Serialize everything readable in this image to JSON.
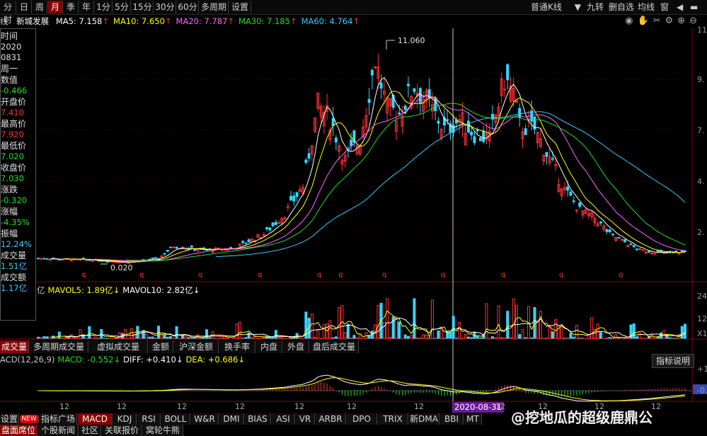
{
  "toolbar": {
    "periods": [
      "分时",
      "日",
      "周",
      "月",
      "季",
      "年",
      "1分",
      "5分",
      "15分",
      "30分",
      "60分",
      "多周期",
      "设置"
    ],
    "active_period": "月",
    "chart_type": "普通K线",
    "right_buttons": [
      "九转",
      "删自选",
      "均线",
      "窗"
    ]
  },
  "ma_line": {
    "prefix": "线",
    "stock_name": "新城发展",
    "items": [
      {
        "text": "MA5: 7.158",
        "color": "#ffffff"
      },
      {
        "text": "MA10: 7.650",
        "color": "#ffff00"
      },
      {
        "text": "MA20: 7.787",
        "color": "#ff66ff"
      },
      {
        "text": "MA30: 7.185",
        "color": "#22dd22"
      },
      {
        "text": "MA60: 4.764",
        "color": "#33ccff"
      }
    ]
  },
  "info_panel": {
    "rows": [
      {
        "label": "时间",
        "value": "2020",
        "value2": "0831"
      },
      {
        "label": "周一",
        "value": ""
      },
      {
        "label": "数值",
        "value": "-0.466",
        "color": "#22dd22"
      },
      {
        "label": "开盘价",
        "value": "7.410",
        "color": "#ff3333"
      },
      {
        "label": "最高价",
        "value": "7.920",
        "color": "#ff3333"
      },
      {
        "label": "最低价",
        "value": "7.020",
        "color": "#22dd22"
      },
      {
        "label": "收盘价",
        "value": "7.030",
        "color": "#22dd22"
      },
      {
        "label": "涨跌",
        "value": "-0.320",
        "color": "#22dd22"
      },
      {
        "label": "涨幅",
        "value": "-4.35%",
        "color": "#22dd22"
      },
      {
        "label": "振幅",
        "value": "12.24%",
        "color": "#33ccff"
      },
      {
        "label": "成交量",
        "value": "1.51亿",
        "color": "#33ccff"
      },
      {
        "label": "成交额",
        "value": "1.17亿",
        "color": "#33ccff"
      }
    ]
  },
  "price_axis": [
    "11",
    "9.",
    "7.",
    "4.",
    "2."
  ],
  "annotations": {
    "high": "11.060",
    "low": "0.020"
  },
  "volume_header": {
    "items": [
      {
        "text": "亿",
        "color": "#c8c8c8"
      },
      {
        "text": "MAVOL5: 1.89亿",
        "color": "#ffff00"
      },
      {
        "text": "MAVOL10: 2.82亿",
        "color": "#ffffff"
      }
    ]
  },
  "volume_axis": [
    "24",
    "12",
    "X1"
  ],
  "indicator_tabs": [
    "成交量",
    "多周期成交量",
    "虚拟成交量",
    "金额",
    "沪深金额",
    "换手率",
    "内盘",
    "外盘",
    "盘后成交量"
  ],
  "macd_header": {
    "items": [
      {
        "text": "ACD(12,26,9)",
        "color": "#c8c8c8"
      },
      {
        "text": "MACD: -0.552",
        "color": "#22dd22"
      },
      {
        "text": "DIFF: +0.410",
        "color": "#ffffff"
      },
      {
        "text": "DEA: +0.686",
        "color": "#ffff00"
      }
    ],
    "help": "指标说明"
  },
  "macd_axis": [
    "+1",
    "-0."
  ],
  "x_axis": {
    "ticks": [
      "12",
      "12",
      "12",
      "12",
      "12",
      "12",
      "12",
      "12",
      "12",
      "12",
      "12"
    ],
    "cursor_date": "2020-08-31"
  },
  "bottom_tabs": [
    "设置",
    "NEW",
    "指标广场",
    "MACD",
    "KDJ",
    "RSI",
    "BOLL",
    "W&R",
    "DMI",
    "BIAS",
    "ASI",
    "VR",
    "ARBR",
    "DPO",
    "TRIX",
    "新DMA",
    "BBI",
    "MT"
  ],
  "bottom_active": "MACD",
  "bottom_tabs2": [
    "盘面席位",
    "个股新闻",
    "社区",
    "关联报价",
    "窝轮牛熊"
  ],
  "watermark": "@挖地瓜的超级鹿鼎公",
  "chart_data": {
    "type": "candlestick",
    "title": "新城发展",
    "period": "月",
    "cursor": {
      "date": "2020-08-31",
      "open": 7.41,
      "high": 7.92,
      "low": 7.02,
      "close": 7.03
    },
    "ma": {
      "MA5": 7.158,
      "MA10": 7.65,
      "MA20": 7.787,
      "MA30": 7.185,
      "MA60": 4.764
    },
    "extremes": {
      "high": 11.06,
      "low": 0.02
    }
  }
}
